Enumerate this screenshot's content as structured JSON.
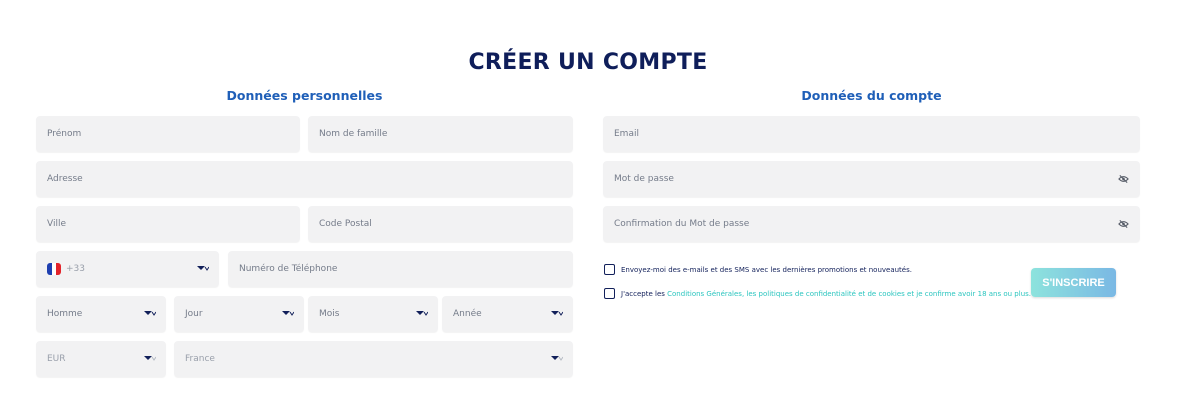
{
  "page": {
    "title": "CRÉER UN COMPTE"
  },
  "personal": {
    "title": "Données personnelles",
    "first_name": "Prénom",
    "last_name": "Nom de famille",
    "address": "Adresse",
    "city": "Ville",
    "postal_code": "Code Postal",
    "phone_code": "+33",
    "phone": "Numéro de Téléphone",
    "gender": "Homme",
    "day": "Jour",
    "month": "Mois",
    "year": "Année",
    "currency": "EUR",
    "country": "France"
  },
  "account": {
    "title": "Données du compte",
    "email": "Email",
    "password": "Mot de passe",
    "password_confirm": "Confirmation du Mot de passe"
  },
  "consent": {
    "marketing": "Envoyez-moi des e-mails et des SMS avec les dernières promotions et nouveautés.",
    "terms_prefix": "J'accepte les ",
    "terms_link": "Conditions Générales",
    "terms_rest": ", les politiques de confidentialité et de cookies et je confirme avoir 18 ans ou plus."
  },
  "submit": {
    "label": "S'INSCRIRE"
  },
  "icons": {
    "chevron": "chevron-down-icon",
    "eye": "eye-slash-icon",
    "flag": "france-flag-icon"
  },
  "colors": {
    "title": "#0f1e5a",
    "section_title": "#1f5fb8",
    "field_bg": "#f2f2f3",
    "link": "#2bc5bf",
    "button_start": "#8de3dd",
    "button_end": "#7ab8e4"
  }
}
